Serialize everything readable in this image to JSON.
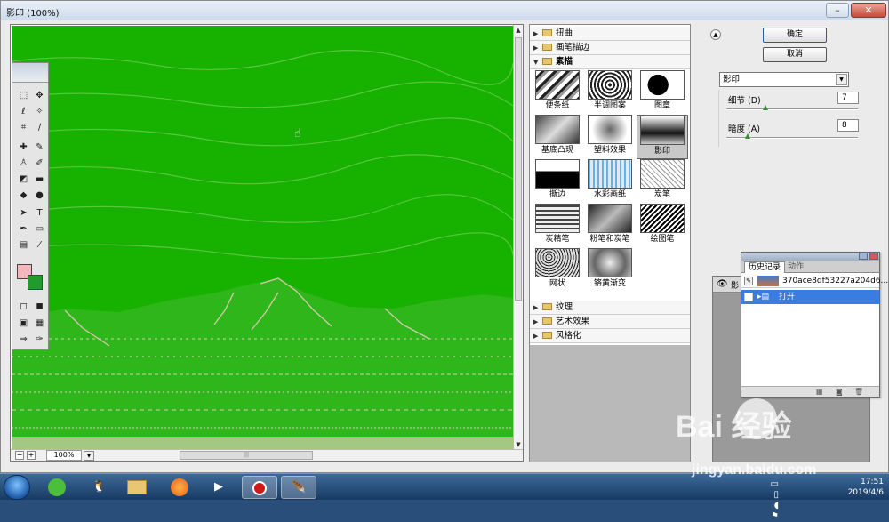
{
  "window": {
    "title": "影印 (100%)"
  },
  "preview": {
    "zoom": "100%",
    "minus": "−",
    "plus": "+"
  },
  "filters": {
    "categories_top": [
      {
        "label": "扭曲",
        "expanded": false
      },
      {
        "label": "画笔描边",
        "expanded": false
      },
      {
        "label": "素描",
        "expanded": true
      }
    ],
    "items": [
      "便条纸",
      "半调图案",
      "图章",
      "基底凸现",
      "塑料效果",
      "影印",
      "撕边",
      "水彩画纸",
      "炭笔",
      "炭精笔",
      "粉笔和炭笔",
      "绘图笔",
      "网状",
      "铬黄渐变"
    ],
    "selected": "影印",
    "categories_bottom": [
      {
        "label": "纹理",
        "expanded": false
      },
      {
        "label": "艺术效果",
        "expanded": false
      },
      {
        "label": "风格化",
        "expanded": false
      }
    ]
  },
  "settings": {
    "ok_label": "确定",
    "cancel_label": "取消",
    "filter_select": "影印",
    "params": [
      {
        "label": "细节 (D)",
        "value": "7",
        "level": 0.3
      },
      {
        "label": "暗度 (A)",
        "value": "8",
        "level": 0.16
      }
    ]
  },
  "history": {
    "tabs": [
      "历史记录",
      "动作"
    ],
    "snapshot": "370ace8df53227a204d6...",
    "steps": [
      "打开"
    ]
  },
  "layers": {
    "partial_label": "影"
  },
  "taskbar": {
    "time": "17:51",
    "date": "2019/4/6"
  },
  "watermark": {
    "brand": "Bai  经验",
    "url": "jingyan.baidu.com"
  },
  "colors": {
    "preview_green": "#17b100",
    "accent_blue": "#3b7ce0",
    "foreground": "#f4b8bc",
    "background": "#1f9c2d"
  }
}
